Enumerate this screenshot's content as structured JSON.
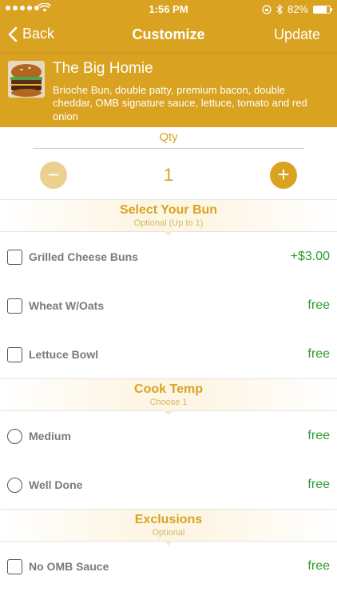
{
  "status_bar": {
    "time": "1:56 PM",
    "battery": "82%",
    "battery_level": 0.82
  },
  "nav": {
    "back_label": "Back",
    "title": "Customize",
    "update_label": "Update"
  },
  "item": {
    "name": "The Big Homie",
    "description": "Brioche Bun, double patty, premium bacon, double cheddar, OMB signature sauce, lettuce, tomato and red onion"
  },
  "quantity": {
    "label": "Qty",
    "value": "1",
    "minus": "−",
    "plus": "+"
  },
  "sections": [
    {
      "title": "Select Your Bun",
      "subtitle": "Optional (Up to 1)",
      "control": "checkbox",
      "options": [
        {
          "label": "Grilled Cheese Buns",
          "price": "+$3.00"
        },
        {
          "label": "Wheat W/Oats",
          "price": "free"
        },
        {
          "label": "Lettuce Bowl",
          "price": "free"
        }
      ]
    },
    {
      "title": "Cook Temp",
      "subtitle": "Choose 1",
      "control": "radio",
      "options": [
        {
          "label": "Medium",
          "price": "free"
        },
        {
          "label": "Well Done",
          "price": "free"
        }
      ]
    },
    {
      "title": "Exclusions",
      "subtitle": "Optional",
      "control": "checkbox",
      "options": [
        {
          "label": "No OMB Sauce",
          "price": "free"
        }
      ]
    }
  ],
  "colors": {
    "accent": "#d9a321",
    "price_green": "#2e9c2e"
  }
}
